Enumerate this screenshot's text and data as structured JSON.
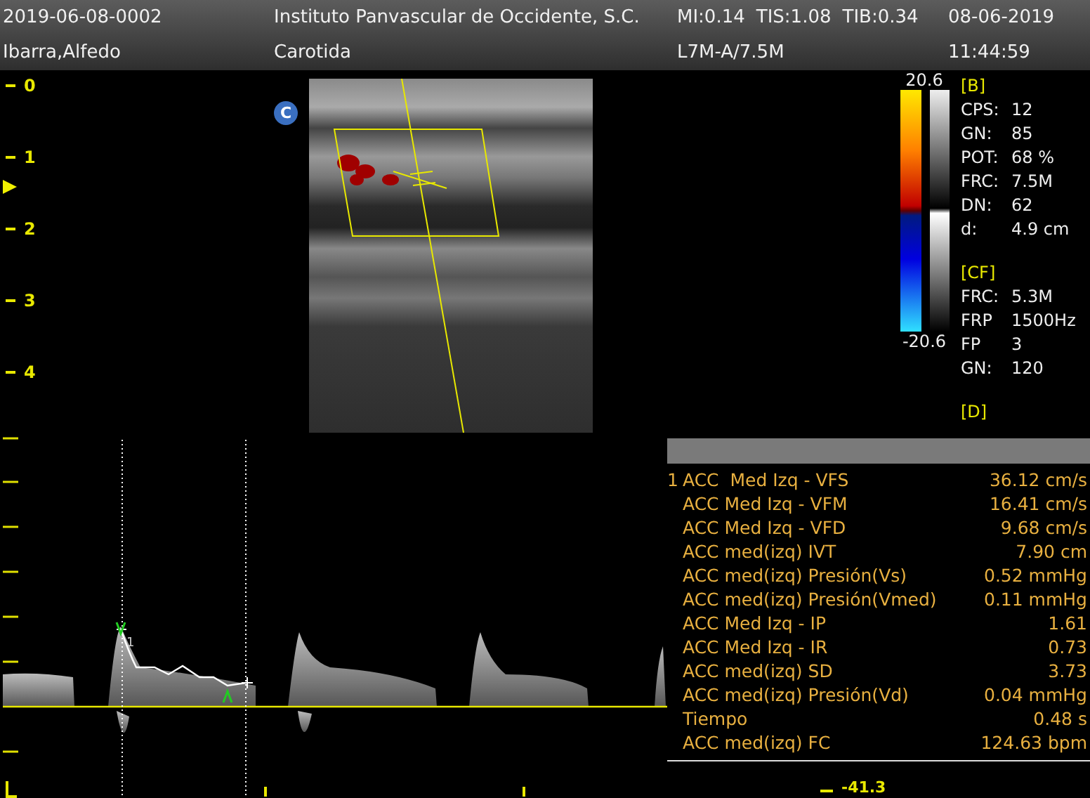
{
  "header": {
    "patient_id": "2019-06-08-0002",
    "institution": "Instituto Panvascular de Occidente, S.C.",
    "indices": [
      "MI:0.14",
      "TIS:1.08",
      "TIB:0.34"
    ],
    "date": "08-06-2019",
    "patient_name": "Ibarra,Alfedo",
    "exam": "Carotida",
    "probe": "L7M-A/7.5M",
    "time": "11:44:59"
  },
  "depth_scale": [
    "0",
    "1",
    "2",
    "3",
    "4"
  ],
  "mode_badge": "C",
  "color_scale": {
    "max": "20.6",
    "min": "-20.6"
  },
  "parameter_sections": [
    {
      "title": "[B]",
      "params": [
        {
          "label": "CPS:",
          "value": "12"
        },
        {
          "label": "GN:",
          "value": "85"
        },
        {
          "label": "POT:",
          "value": "68 %"
        },
        {
          "label": "FRC:",
          "value": "7.5M"
        },
        {
          "label": "DN:",
          "value": "62"
        },
        {
          "label": "d:",
          "value": "4.9 cm"
        }
      ]
    },
    {
      "title": "[CF]",
      "params": [
        {
          "label": "FRC:",
          "value": "5.3M"
        },
        {
          "label": "FRP",
          "value": "1500Hz"
        },
        {
          "label": "FP",
          "value": "3"
        },
        {
          "label": "GN:",
          "value": "120"
        }
      ]
    },
    {
      "title": "[D]"
    }
  ],
  "spectrum": {
    "trace_label": "1"
  },
  "measurements": [
    {
      "index": "1",
      "label": "ACC  Med Izq - VFS",
      "value": "36.12 cm/s"
    },
    {
      "label": "ACC Med Izq - VFM",
      "value": "16.41 cm/s"
    },
    {
      "label": "ACC Med Izq - VFD",
      "value": "9.68 cm/s"
    },
    {
      "label": "ACC med(izq) IVT",
      "value": "7.90 cm"
    },
    {
      "label": "ACC med(izq) Presión(Vs)",
      "value": "0.52 mmHg"
    },
    {
      "label": "ACC med(izq) Presión(Vmed)",
      "value": "0.11 mmHg"
    },
    {
      "label": "ACC Med Izq - IP",
      "value": "1.61"
    },
    {
      "label": "ACC Med Izq - IR",
      "value": "0.73"
    },
    {
      "label": "ACC med(izq) SD",
      "value": "3.73"
    },
    {
      "label": "ACC med(izq) Presión(Vd)",
      "value": "0.04 mmHg"
    },
    {
      "label": "Tiempo",
      "value": "0.48 s"
    },
    {
      "label": "ACC med(izq) FC",
      "value": "124.63 bpm"
    }
  ],
  "velocity_scale_min": "-41.3"
}
